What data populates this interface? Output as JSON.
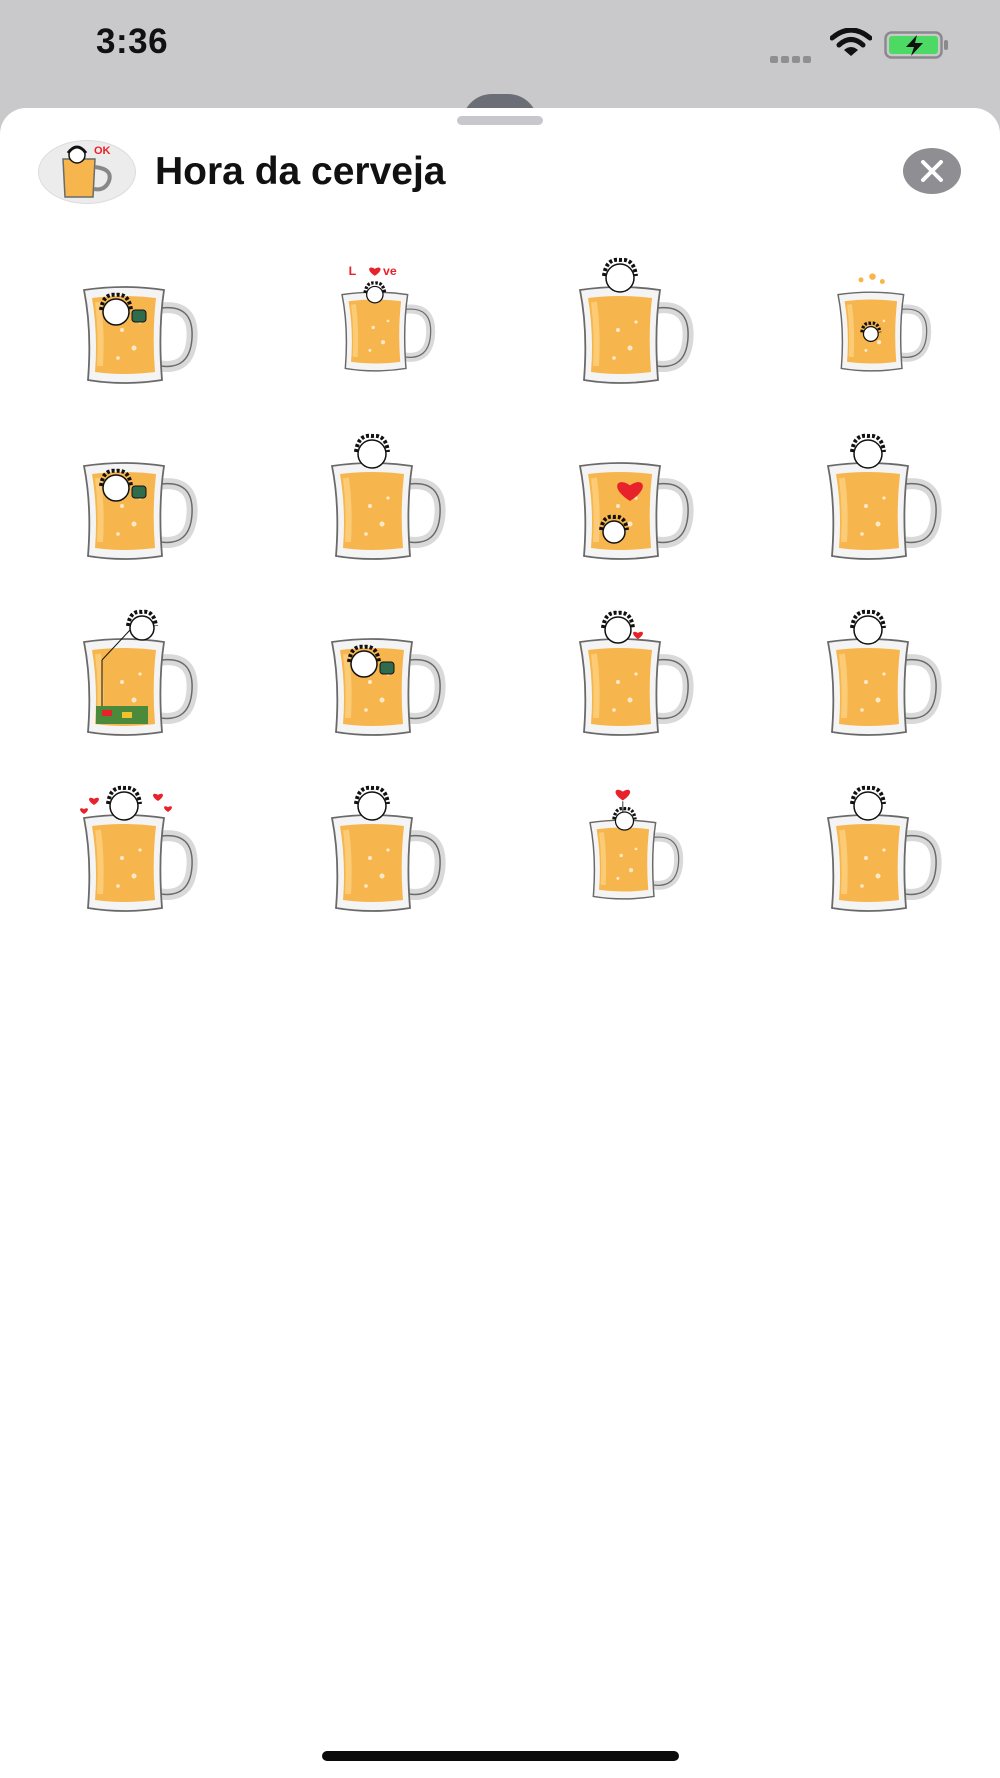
{
  "status_bar": {
    "time": "3:36",
    "icons": [
      "cellular-icon",
      "wifi-icon",
      "battery-charging-icon"
    ],
    "battery_color": "#4cd964"
  },
  "sheet": {
    "title": "Hora da cerveja",
    "app_icon": {
      "icon": "beer-mug-ok-icon",
      "badge_text": "OK"
    },
    "close_icon": "close-icon",
    "stickers": [
      {
        "variant": "thumbs-up",
        "label": ""
      },
      {
        "variant": "love",
        "label": "Love"
      },
      {
        "variant": "peek",
        "label": ""
      },
      {
        "variant": "splash",
        "label": ""
      },
      {
        "variant": "thumbs-up",
        "label": ""
      },
      {
        "variant": "peek",
        "label": ""
      },
      {
        "variant": "heart-inside",
        "label": ""
      },
      {
        "variant": "peek",
        "label": ""
      },
      {
        "variant": "fishing",
        "label": ""
      },
      {
        "variant": "thumbs-up",
        "label": ""
      },
      {
        "variant": "peek-heart",
        "label": ""
      },
      {
        "variant": "peek",
        "label": ""
      },
      {
        "variant": "hearts-eyes",
        "label": ""
      },
      {
        "variant": "peek",
        "label": ""
      },
      {
        "variant": "heart-balloon",
        "label": ""
      },
      {
        "variant": "peek",
        "label": ""
      }
    ],
    "colors": {
      "beer": "#f7b64d",
      "beer_light": "#fbd27f",
      "glass": "#f4f4f4",
      "glass_outline": "#6a6a6a",
      "heart": "#e8222a"
    }
  }
}
